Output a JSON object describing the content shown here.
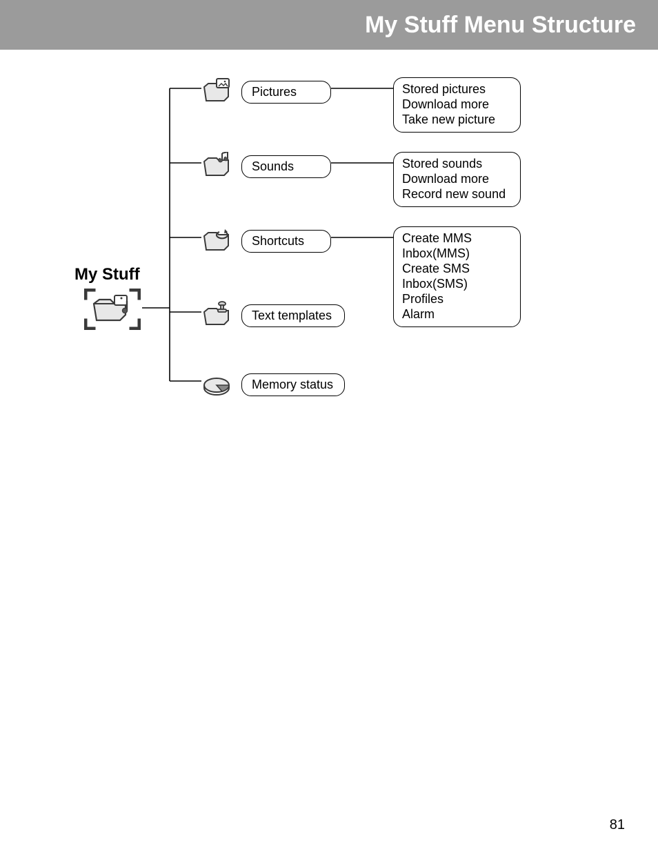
{
  "header": {
    "title": "My Stuff Menu Structure"
  },
  "page_number": "81",
  "root": {
    "label": "My Stuff"
  },
  "categories": [
    {
      "label": "Pictures",
      "icon": "folder-photo-icon",
      "sub": [
        "Stored pictures",
        "Download more",
        "Take new picture"
      ]
    },
    {
      "label": "Sounds",
      "icon": "folder-music-icon",
      "sub": [
        "Stored sounds",
        "Download more",
        "Record new sound"
      ]
    },
    {
      "label": "Shortcuts",
      "icon": "folder-arrow-icon",
      "sub": [
        "Create MMS",
        "Inbox(MMS)",
        "Create SMS",
        "Inbox(SMS)",
        "Profiles",
        "Alarm"
      ]
    },
    {
      "label": "Text templates",
      "icon": "folder-stamp-icon",
      "sub": []
    },
    {
      "label": "Memory status",
      "icon": "pie-chart-icon",
      "sub": []
    }
  ]
}
